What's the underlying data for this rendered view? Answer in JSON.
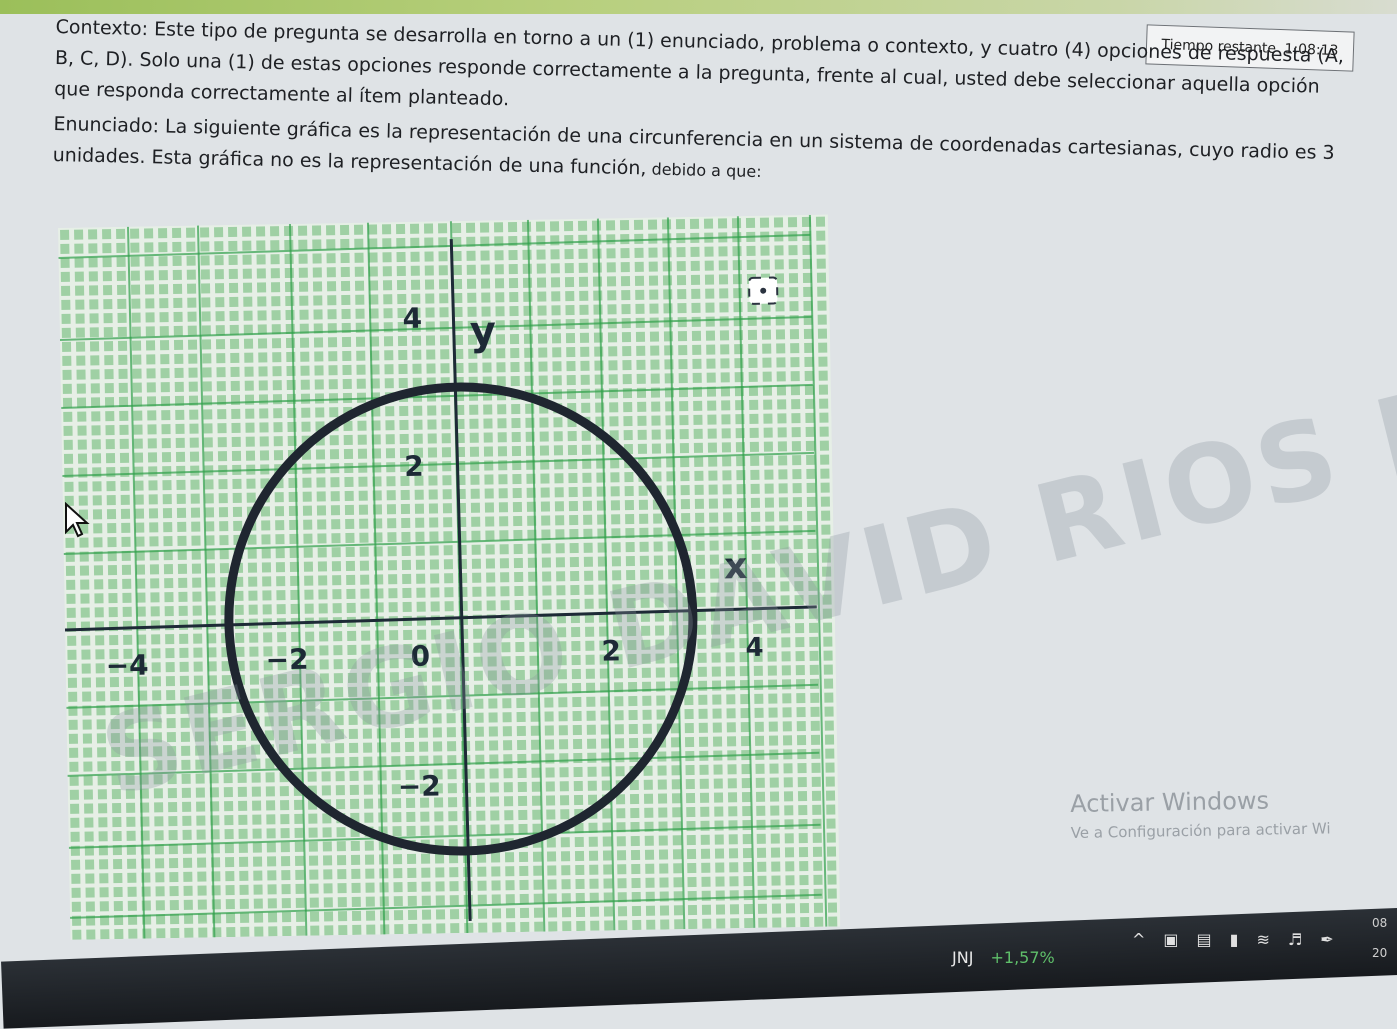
{
  "timer": {
    "label": "Tiempo restante",
    "value": "1:08:13"
  },
  "question": {
    "context": "Contexto: Este tipo de pregunta se desarrolla en torno a un (1) enunciado, problema o contexto, y cuatro (4) opciones de respuesta (A, B, C, D). Solo una (1) de estas opciones responde correctamente a la pregunta, frente al cual, usted debe seleccionar aquella opción que responda correctamente al ítem planteado.",
    "statement_main": "Enunciado: La siguiente gráfica es la representación de una circunferencia en un sistema de coordenadas cartesianas, cuyo radio es 3 unidades. Esta gráfica no es la representación de una función,",
    "statement_small": " debido a que:"
  },
  "graph": {
    "y_axis_label": "y",
    "x_axis_label": "x",
    "x_tick_labels": [
      "−4",
      "−2",
      "0",
      "2",
      "4"
    ],
    "y_tick_labels": [
      "4",
      "2",
      "−2"
    ],
    "focus_icon": "scan-focus-icon"
  },
  "watermark": "SERGIO DAVID RIOS LOZANO",
  "windows": {
    "title": "Activar Windows",
    "subtitle": "Ve a Configuración para activar Wi"
  },
  "taskbar": {
    "ticker_symbol": "JNJ",
    "ticker_change": "+1,57%",
    "clock_time": "08",
    "clock_date": "20",
    "icons": [
      "chevron-up-icon",
      "camera-icon",
      "note-icon",
      "battery-icon",
      "wifi-icon",
      "volume-icon",
      "pen-icon"
    ]
  },
  "colors": {
    "grid": "#2fa04a",
    "grid_fill": "#9fd0a4",
    "axis": "#1d2a36",
    "circle": "#1f2630"
  }
}
